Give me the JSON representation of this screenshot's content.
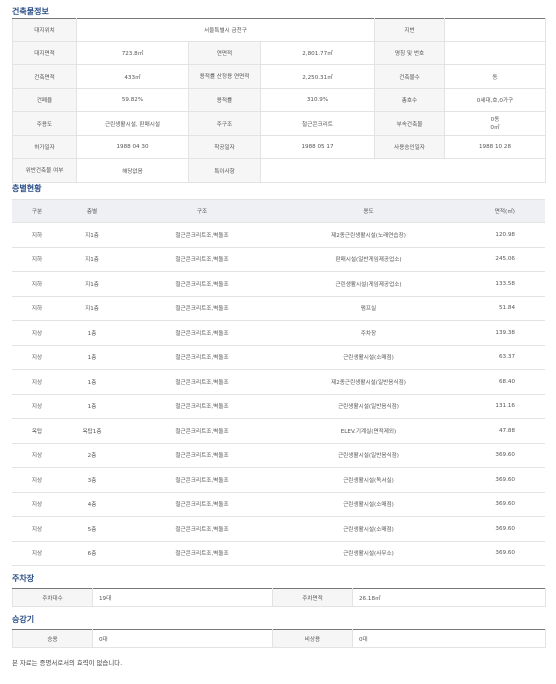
{
  "building_info": {
    "title": "건축물정보",
    "location_label": "대지위치",
    "location_value": "서울특별시 금천구",
    "lot_label": "지번",
    "lot_value": "",
    "site_area_label": "대지면적",
    "site_area_value": "723.8㎡",
    "floor_area_label": "연면적",
    "floor_area_value": "2,801.77㎡",
    "name_label": "명칭 및 번호",
    "name_value": "",
    "building_area_label": "건축면적",
    "building_area_value": "433㎡",
    "far_area_label": "용적률 산정용 연면적",
    "far_area_value": "2,250.31㎡",
    "bldg_count_label": "건축물수",
    "bldg_count_value": "동",
    "coverage_label": "건폐율",
    "coverage_value": "59.82%",
    "far_label": "용적률",
    "far_value": "310.9%",
    "households_label": "총호수",
    "households_value": "0세대,호,0가구",
    "main_use_label": "주용도",
    "main_use_value": "근린생활시설, 판매시설",
    "structure_label": "주구조",
    "structure_value": "철근콘크리트",
    "annex_label": "부속건축물",
    "annex_value_1": "0동",
    "annex_value_2": "0㎡",
    "permit_label": "허가일자",
    "permit_value": "1988 04 30",
    "start_label": "착공일자",
    "start_value": "1988 05 17",
    "approval_label": "사용승인일자",
    "approval_value": "1988 10 28",
    "violation_label": "위반건축물 여부",
    "violation_value": "해당없음",
    "special_label": "특이사항",
    "special_value": ""
  },
  "floors": {
    "title": "층별현황",
    "headers": {
      "type": "구분",
      "floor": "층별",
      "structure": "구조",
      "use": "용도",
      "area": "면적(㎡)"
    },
    "rows": [
      {
        "type": "지하",
        "floor": "지1층",
        "structure": "철근콘크리트조,벽돌조",
        "use": "제2종근린생활시설(노래연습장)",
        "area": "120.98"
      },
      {
        "type": "지하",
        "floor": "지1층",
        "structure": "철근콘크리트조,벽돌조",
        "use": "판매시설(일반게임제공업소)",
        "area": "245.06"
      },
      {
        "type": "지하",
        "floor": "지1층",
        "structure": "철근콘크리트조,벽돌조",
        "use": "근린생활시설(게임제공업소)",
        "area": "133.58"
      },
      {
        "type": "지하",
        "floor": "지1층",
        "structure": "철근콘크리트조,벽돌조",
        "use": "펌프실",
        "area": "51.84"
      },
      {
        "type": "지상",
        "floor": "1층",
        "structure": "철근콘크리트조,벽돌조",
        "use": "주차장",
        "area": "139.38"
      },
      {
        "type": "지상",
        "floor": "1층",
        "structure": "철근콘크리트조,벽돌조",
        "use": "근린생활시설(소매점)",
        "area": "63.37"
      },
      {
        "type": "지상",
        "floor": "1층",
        "structure": "철근콘크리트조,벽돌조",
        "use": "제2종근린생활시설(일반음식점)",
        "area": "68.40"
      },
      {
        "type": "지상",
        "floor": "1층",
        "structure": "철근콘크리트조,벽돌조",
        "use": "근린생활시설(일반음식점)",
        "area": "131.16"
      },
      {
        "type": "옥탑",
        "floor": "옥탑1층",
        "structure": "철근콘크리트조,벽돌조",
        "use": "ELEV.기계실(면적제외)",
        "area": "47.88"
      },
      {
        "type": "지상",
        "floor": "2층",
        "structure": "철근콘크리트조,벽돌조",
        "use": "근린생활시설(일반음식점)",
        "area": "369.60"
      },
      {
        "type": "지상",
        "floor": "3층",
        "structure": "철근콘크리트조,벽돌조",
        "use": "근린생활시설(독서실)",
        "area": "369.60"
      },
      {
        "type": "지상",
        "floor": "4층",
        "structure": "철근콘크리트조,벽돌조",
        "use": "근린생활시설(소매점)",
        "area": "369.60"
      },
      {
        "type": "지상",
        "floor": "5층",
        "structure": "철근콘크리트조,벽돌조",
        "use": "근린생활시설(소매점)",
        "area": "369.60"
      },
      {
        "type": "지상",
        "floor": "6층",
        "structure": "철근콘크리트조,벽돌조",
        "use": "근린생활시설(사무소)",
        "area": "369.60"
      }
    ]
  },
  "parking": {
    "title": "주차장",
    "count_label": "주차대수",
    "count_value": "19대",
    "area_label": "주차면적",
    "area_value": "26.18㎡"
  },
  "elevator": {
    "title": "승강기",
    "passenger_label": "승용",
    "passenger_value": "0대",
    "emergency_label": "비상용",
    "emergency_value": "0대"
  },
  "footnote": "본 자료는 증명서로서의 효력이 없습니다."
}
